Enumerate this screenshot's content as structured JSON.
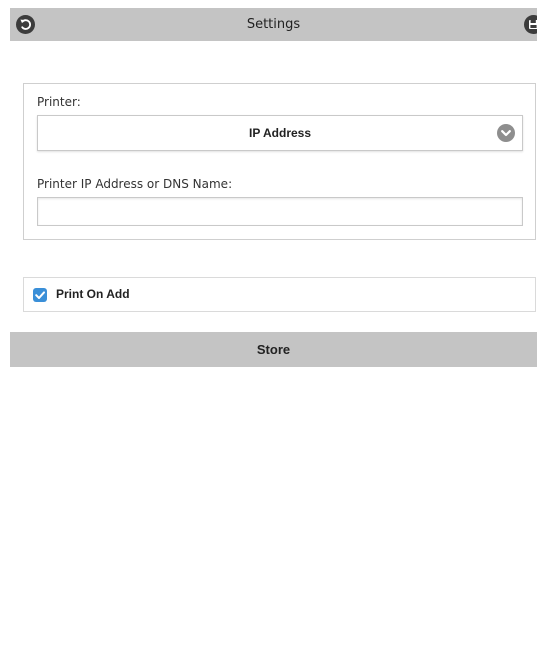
{
  "header": {
    "title": "Settings",
    "back_icon": "undo-icon",
    "save_icon": "floppy-disk-icon"
  },
  "printer_section": {
    "printer_label": "Printer:",
    "printer_select": {
      "selected": "IP Address",
      "icon": "chevron-down-icon"
    },
    "ip_label": "Printer IP Address or DNS Name:",
    "ip_input": {
      "value": "",
      "placeholder": ""
    }
  },
  "print_on_add": {
    "label": "Print On Add",
    "checked": true
  },
  "store_button": {
    "label": "Store"
  },
  "colors": {
    "header_bg": "#c4c4c4",
    "checkbox_accent": "#3a8fd8",
    "button_bg": "#c4c4c4"
  }
}
